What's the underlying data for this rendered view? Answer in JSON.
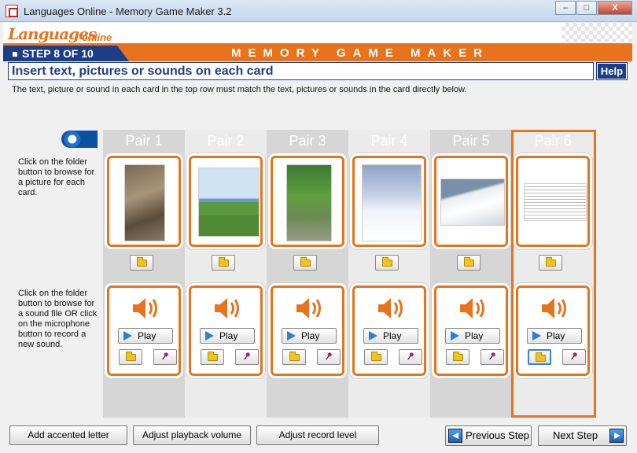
{
  "window": {
    "title": "Languages Online - Memory Game Maker 3.2",
    "minimize": "–",
    "maximize": "□",
    "close": "X"
  },
  "header": {
    "logo": "Languages",
    "logo_suffix": "online",
    "step": "STEP 8 OF 10",
    "app_name": "MEMORY GAME MAKER",
    "accent": "#e8731c",
    "navy": "#1d3d87"
  },
  "instruction": {
    "heading": "Insert text, pictures or sounds on each card",
    "help_label": "Help",
    "description": "The text, picture or sound in each card in the top row must match the text, pictures or sounds in the card directly below."
  },
  "side_help": {
    "picture": "Click on the folder button to browse for a picture for each card.",
    "sound": "Click on the folder button to browse for a sound file OR click on the microphone button to record a new sound."
  },
  "pairs": [
    {
      "title": "Pair 1",
      "picture": "climbers-photo",
      "play_label": "Play"
    },
    {
      "title": "Pair 2",
      "picture": "paraglider-photo",
      "play_label": "Play"
    },
    {
      "title": "Pair 3",
      "picture": "cyclist-photo",
      "play_label": "Play"
    },
    {
      "title": "Pair 4",
      "picture": "hiker-photo",
      "play_label": "Play"
    },
    {
      "title": "Pair 5",
      "picture": "skier-photo",
      "play_label": "Play"
    },
    {
      "title": "Pair 6",
      "picture": "document-photo",
      "play_label": "Play"
    }
  ],
  "footer": {
    "accented_letter": "Add accented letter",
    "playback_volume": "Adjust playback volume",
    "record_level": "Adjust record level",
    "previous": "Previous Step",
    "next": "Next Step"
  }
}
